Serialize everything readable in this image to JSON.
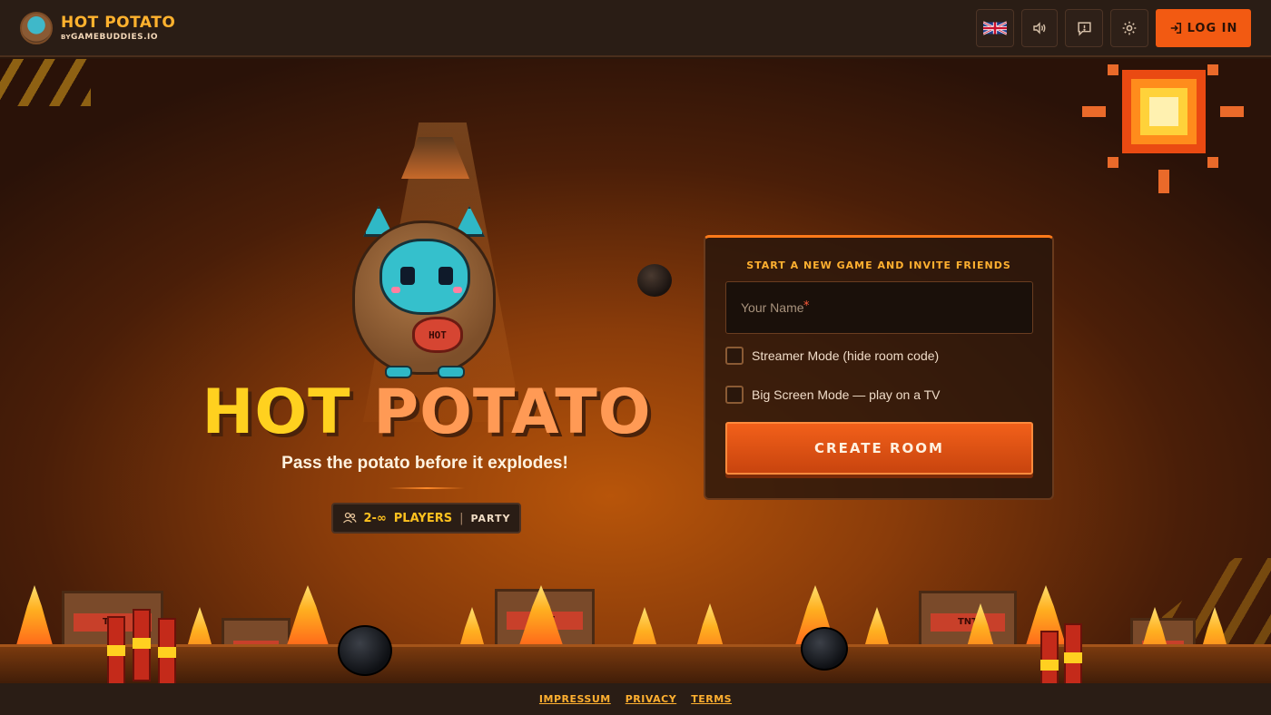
{
  "header": {
    "brand_title": "HOT POTATO",
    "brand_by": "BY",
    "brand_sub": "GAMEBUDDIES.IO",
    "login_label": "LOG IN",
    "icons": {
      "language": "uk-flag-icon",
      "sound": "speaker-icon",
      "feedback": "message-icon",
      "settings": "gear-icon",
      "login": "login-arrow-icon"
    }
  },
  "hero": {
    "title_word1": "HOT",
    "title_word2": "POTATO",
    "mascot_sign": "HOT",
    "tagline": "Pass the potato before it explodes!",
    "players_count": "2-∞",
    "players_label": "PLAYERS",
    "players_sep": "|",
    "genre": "PARTY"
  },
  "form": {
    "heading": "START A NEW GAME AND INVITE FRIENDS",
    "name_placeholder": "Your Name",
    "name_value": "",
    "required_mark": "*",
    "streamer_label": "Streamer Mode (hide room code)",
    "streamer_checked": false,
    "bigscreen_label": "Big Screen Mode — play on a TV",
    "bigscreen_checked": false,
    "create_label": "CREATE ROOM"
  },
  "scene": {
    "tnt_text": "TNT"
  },
  "footer": {
    "impressum": "IMPRESSUM",
    "privacy": "PRIVACY",
    "terms": "TERMS"
  },
  "colors": {
    "accent": "#f25a12",
    "title_yellow": "#ffd11f",
    "title_orange": "#ff9a55",
    "link": "#ffb030"
  }
}
